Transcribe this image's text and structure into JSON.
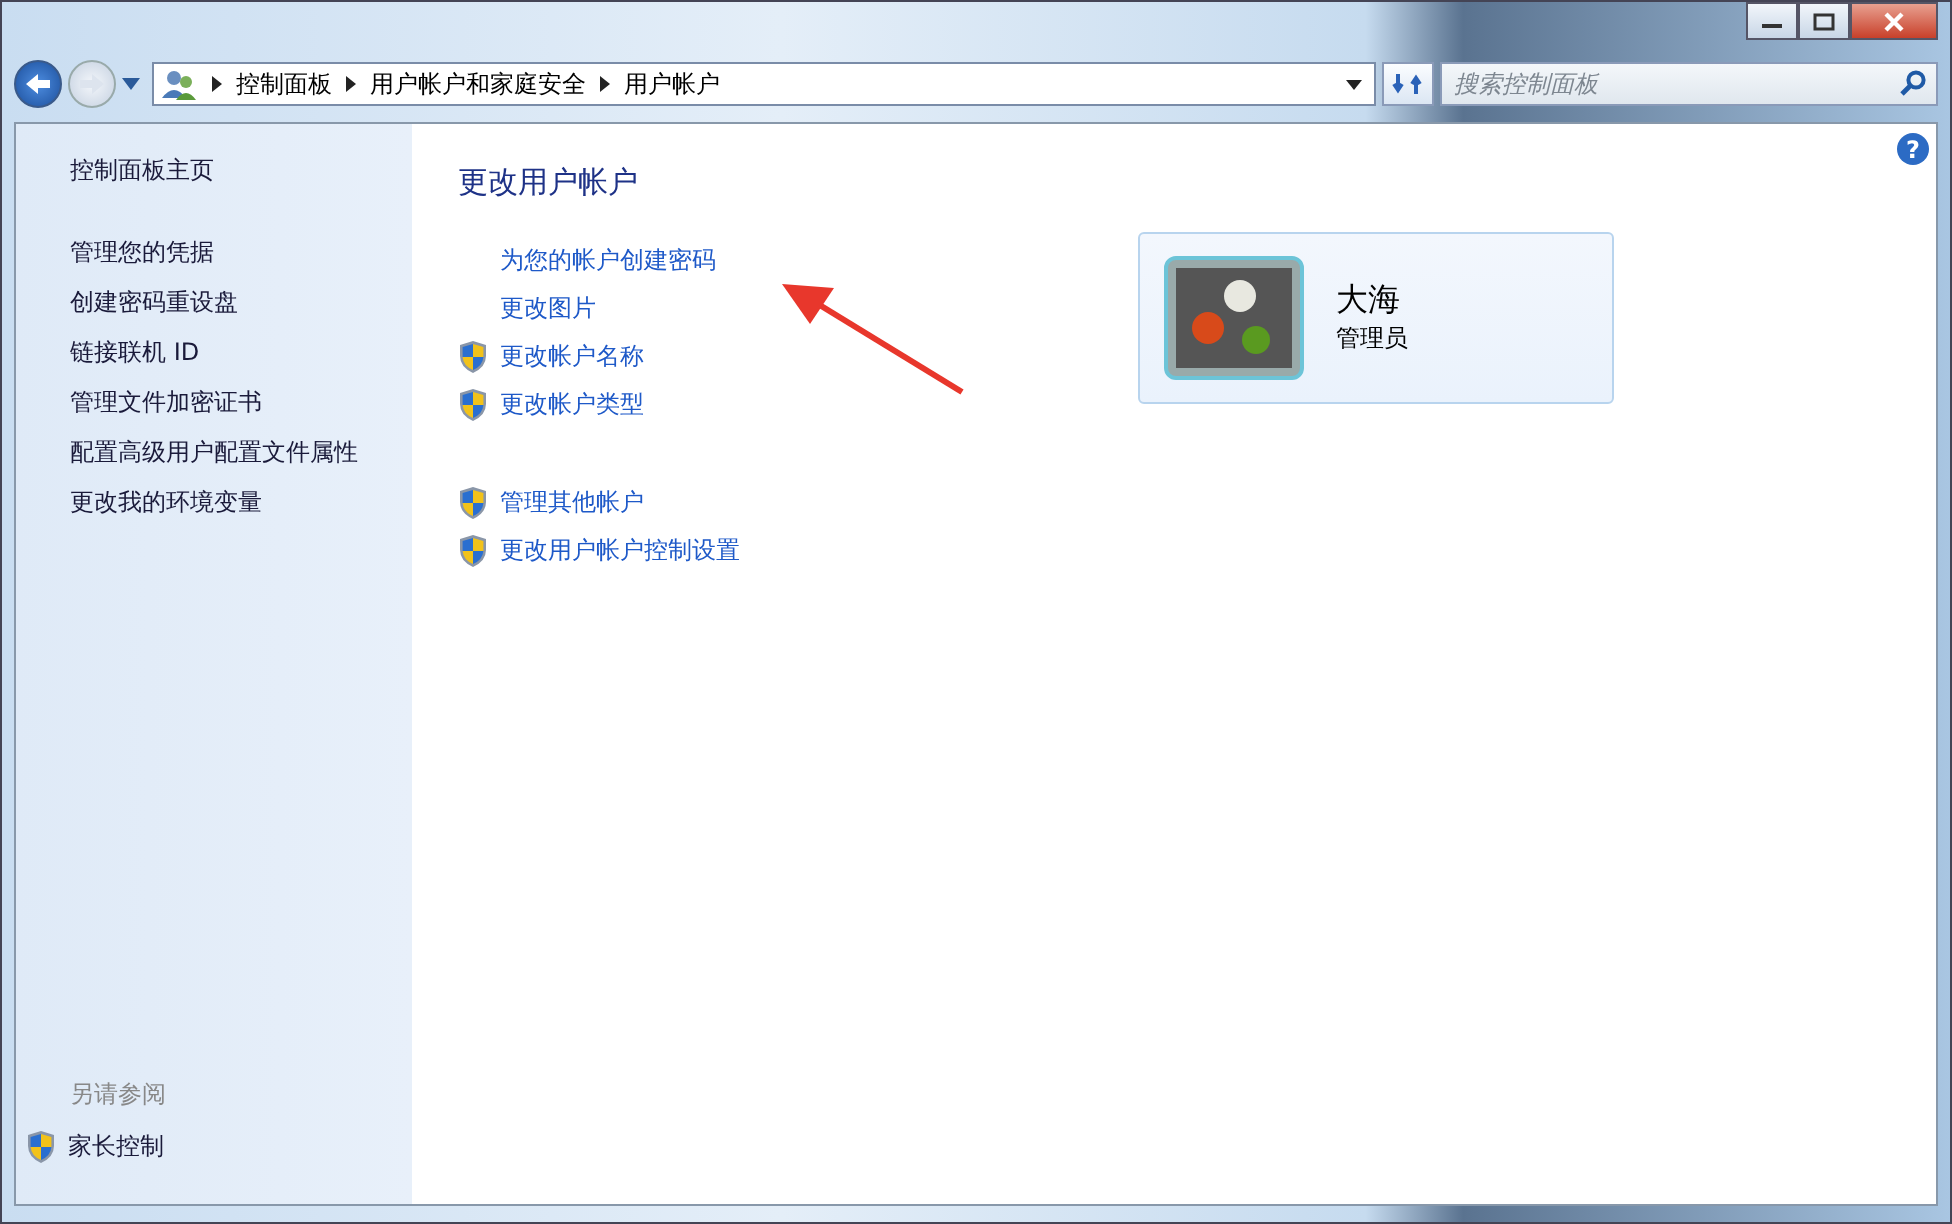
{
  "breadcrumb": [
    "控制面板",
    "用户帐户和家庭安全",
    "用户帐户"
  ],
  "search": {
    "placeholder": "搜索控制面板"
  },
  "help_button": "?",
  "sidebar": {
    "home": "控制面板主页",
    "items": [
      "管理您的凭据",
      "创建密码重设盘",
      "链接联机 ID",
      "管理文件加密证书",
      "配置高级用户配置文件属性",
      "更改我的环境变量"
    ],
    "see_also_title": "另请参阅",
    "see_also": [
      {
        "label": "家长控制",
        "shield": true
      }
    ]
  },
  "main": {
    "title": "更改用户帐户",
    "tasks": [
      {
        "label": "为您的帐户创建密码",
        "shield": false
      },
      {
        "label": "更改图片",
        "shield": false
      },
      {
        "label": "更改帐户名称",
        "shield": true
      },
      {
        "label": "更改帐户类型",
        "shield": true
      }
    ],
    "other_tasks": [
      {
        "label": "管理其他帐户",
        "shield": true
      },
      {
        "label": "更改用户帐户控制设置",
        "shield": true
      }
    ],
    "account": {
      "name": "大海",
      "role": "管理员"
    }
  }
}
